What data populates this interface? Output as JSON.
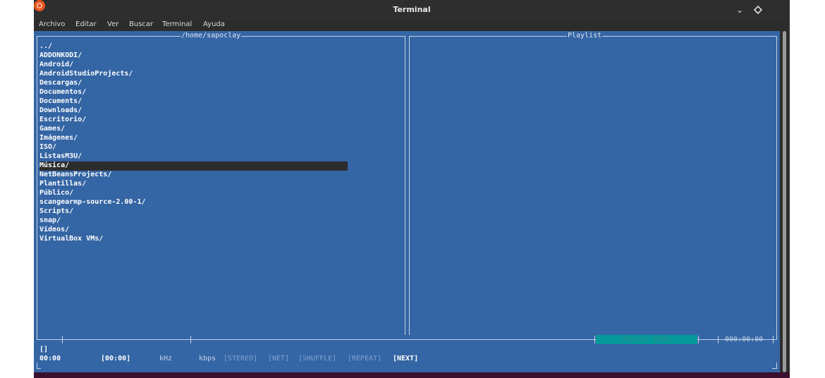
{
  "window": {
    "title": "Terminal"
  },
  "menu": [
    "Archivo",
    "Editar",
    "Ver",
    "Buscar",
    "Terminal",
    "Ayuda"
  ],
  "left_panel": {
    "title": "/home/sapoclay",
    "files": [
      "../",
      "ADDONKODI/",
      "Android/",
      "AndroidStudioProjects/",
      "Descargas/",
      "Documentos/",
      "Documents/",
      "Downloads/",
      "Escritorio/",
      "Games/",
      "Imágenes/",
      "ISO/",
      "ListasM3U/",
      "Música/",
      "NetBeansProjects/",
      "Plantillas/",
      "Público/",
      "scangearmp-source-2.00-1/",
      "Scripts/",
      "snap/",
      "Vídeos/",
      "VirtualBox VMs/"
    ],
    "selected_index": 13
  },
  "right_panel": {
    "title": "Playlist"
  },
  "status": {
    "master": "Master 100%",
    "total_time": "000:00:00",
    "track": "[]",
    "time": "00:00",
    "bracket_time": "[00:00]",
    "khz": "kHz",
    "kbps": "kbps",
    "flags": [
      "[STEREO]",
      "[NET]",
      "[SHUFFLE]",
      "[REPEAT]"
    ],
    "next": "[NEXT]"
  },
  "colors": {
    "terminal_bg": "#3465a4",
    "selection_bg": "#2c2c2c",
    "master_bar": "#06989a",
    "close_button": "#e95420"
  }
}
